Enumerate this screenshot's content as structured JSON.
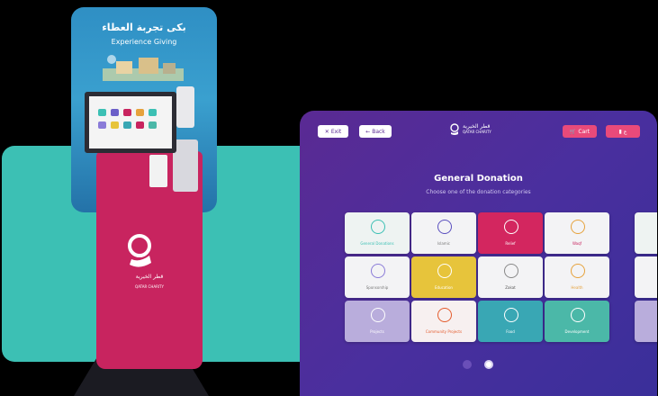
{
  "kiosk": {
    "poster_title_ar": "بكى تجربة العطاء",
    "poster_title_en": "Experience Giving",
    "org_name_ar": "قطر الخيرية",
    "org_name_en": "QATAR CHARITY"
  },
  "tablet": {
    "exit_label": "Exit",
    "back_label": "Back",
    "logo_ar": "قطر الخيرية",
    "logo_en": "QATAR CHARITY",
    "cart_label": "Cart",
    "lang_label": "ع",
    "title": "General Donation",
    "subtitle": "Choose one of the donation categories",
    "tiles": [
      {
        "label": "General Donations",
        "color": "#eef3f2",
        "icon": "hands-icon",
        "accent": "#3cc0b4",
        "text": "#3cc0b4"
      },
      {
        "label": "Islamic",
        "color": "#f3f3f5",
        "icon": "sparkle-icon",
        "accent": "#5a4fbf",
        "text": "#777"
      },
      {
        "label": "Relief",
        "color": "#d3265f",
        "icon": "heart-icon",
        "accent": "#ffffff",
        "text": "#fff"
      },
      {
        "label": "Waqf",
        "color": "#f3f3f5",
        "icon": "mosque-icon",
        "accent": "#e6a23c",
        "text": "#c8245f"
      },
      {
        "label": "Sponsorship",
        "color": "#f3f3f5",
        "icon": "pen-icon",
        "accent": "#8a7bd8",
        "text": "#777"
      },
      {
        "label": "Education",
        "color": "#e7c43b",
        "icon": "book-icon",
        "accent": "#ffffff",
        "text": "#fff"
      },
      {
        "label": "Zakat",
        "color": "#f3f3f5",
        "icon": "coin-icon",
        "accent": "#888",
        "text": "#555"
      },
      {
        "label": "Health",
        "color": "#f3f3f5",
        "icon": "drop-icon",
        "accent": "#e6a23c",
        "text": "#e6a23c"
      },
      {
        "label": "Projects",
        "color": "#b9addc",
        "icon": "house-icon",
        "accent": "#ffffff",
        "text": "#fff"
      },
      {
        "label": "Community Projects",
        "color": "#f7f0f0",
        "icon": "pin-icon",
        "accent": "#e45b2c",
        "text": "#e45b2c"
      },
      {
        "label": "Food",
        "color": "#39a7b4",
        "icon": "bowl-icon",
        "accent": "#ffffff",
        "text": "#fff"
      },
      {
        "label": "Development",
        "color": "#4bb8a8",
        "icon": "tree-icon",
        "accent": "#ffffff",
        "text": "#fff"
      }
    ]
  }
}
